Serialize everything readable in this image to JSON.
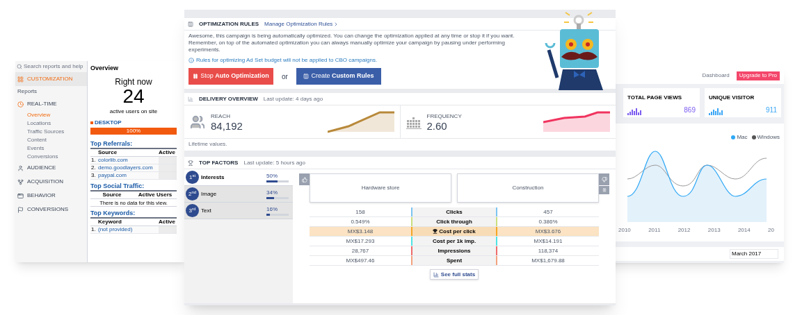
{
  "analytics_window": {
    "search": {
      "placeholder": "Search reports and help"
    },
    "sidebar": {
      "items": [
        {
          "kind": "item",
          "label": "CUSTOMIZATION",
          "selected": true
        },
        {
          "kind": "heading",
          "label": "Reports"
        },
        {
          "kind": "item",
          "label": "REAL-TIME",
          "selected": false,
          "expanded": true,
          "children": [
            {
              "label": "Overview",
              "selected": true
            },
            {
              "label": "Locations",
              "selected": false
            },
            {
              "label": "Traffic Sources",
              "selected": false
            },
            {
              "label": "Content",
              "selected": false
            },
            {
              "label": "Events",
              "selected": false
            },
            {
              "label": "Conversions",
              "selected": false
            }
          ]
        },
        {
          "kind": "item",
          "label": "AUDIENCE",
          "selected": false
        },
        {
          "kind": "item",
          "label": "ACQUISITION",
          "selected": false
        },
        {
          "kind": "item",
          "label": "BEHAVIOR",
          "selected": false
        },
        {
          "kind": "item",
          "label": "CONVERSIONS",
          "selected": false
        }
      ]
    },
    "title": "Overview",
    "right_now": {
      "heading": "Right now",
      "count": "24",
      "caption": "active users on site",
      "device": "DESKTOP",
      "bar_label": "100%",
      "level": 1
    },
    "tables": [
      {
        "title": "Top Referrals:",
        "columns": [
          "",
          "Source",
          "Active"
        ],
        "rows": [
          [
            "1.",
            "colorlib.com"
          ],
          [
            "2.",
            "demo.goodlayers.com"
          ],
          [
            "3.",
            "paypal.com"
          ]
        ]
      },
      {
        "title": "Top Social Traffic:",
        "columns": [
          "Source",
          "Active Users"
        ],
        "empty": "There is no data for this view."
      },
      {
        "title": "Top Keywords:",
        "columns": [
          "",
          "Keyword",
          "Active"
        ],
        "rows": [
          [
            "1.",
            "(not provided)"
          ]
        ]
      }
    ]
  },
  "optimizer_window": {
    "rules": {
      "title": "OPTIMIZATION RULES",
      "link": "Manage Optimization Rules",
      "text": "Awesome, this campaign is being automatically optimized. You can change the optimization applied at any time or stop it if you want. Remember, on top of the automated optimization you can always manually optimize your campaign by pausing under performing experiments.",
      "note": "Rules for optimizing Ad Set budget will not be applied to CBO campaigns.",
      "buttons": [
        {
          "kind": "stop",
          "label": "Stop **Auto Optimization**"
        },
        {
          "kind": "create",
          "label": "Create **Custom Rules**"
        }
      ],
      "separator": "or"
    },
    "delivery": {
      "title": "DELIVERY OVERVIEW",
      "updated": "Last update: 4 days ago",
      "metrics": [
        {
          "kind": "people",
          "label": "REACH",
          "value": "84,192"
        },
        {
          "kind": "bars",
          "label": "FREQUENCY",
          "value": "2.60"
        }
      ],
      "footer": "Lifetime values."
    },
    "factors": {
      "title": "TOP FACTORS",
      "updated": "Last update: 5 hours ago",
      "items": [
        {
          "rank": "1$^{st}$",
          "name": "Interests",
          "percent": "50%",
          "level": 0.5,
          "selected": true
        },
        {
          "rank": "2$^{nd}$",
          "name": "Image",
          "percent": "34%",
          "level": 0.34,
          "selected": false
        },
        {
          "rank": "3$^{rd}$",
          "name": "Text",
          "percent": "16%",
          "level": 0.16,
          "selected": false
        }
      ],
      "compare": [
        "Hardware store",
        "Construction"
      ],
      "rows": [
        {
          "a": "158",
          "metric": "Clicks",
          "b": "457",
          "color": "#7cc4f0",
          "highlighted": false
        },
        {
          "a": "0.549%",
          "metric": "Click through",
          "b": "0.386%",
          "color": "#c9df7e",
          "highlighted": false
        },
        {
          "a": "MX$3.148",
          "metric": "Cost per click",
          "b": "MX$3.676",
          "color": "#f5a623",
          "highlighted": true
        },
        {
          "a": "MX$17.293",
          "metric": "Cost per 1k imp.",
          "b": "MX$14.191",
          "color": "#4fe3e3",
          "highlighted": false
        },
        {
          "a": "28,767",
          "metric": "Impressions",
          "b": "118,374",
          "color": "#ef6b6b",
          "highlighted": false
        },
        {
          "a": "MX$497.46",
          "metric": "Spent",
          "b": "MX$1,679.88",
          "color": "#f3a27e",
          "highlighted": false
        }
      ],
      "button": "See full stats"
    }
  },
  "dashboard_window": {
    "nav": {
      "link": "Dashboard",
      "button": "Upgrade to Pro"
    },
    "cards": [
      {
        "title": "TOTAL PAGE VIEWS",
        "value": "869",
        "color": "#7c5cf0"
      },
      {
        "title": "UNIQUE VISITOR",
        "value": "911",
        "color": "#3aa6f5"
      }
    ],
    "legend": [
      {
        "name": "Mac",
        "color": "#2fa8f5"
      },
      {
        "name": "Windows",
        "color": "#555555"
      }
    ],
    "xticks": [
      "2010",
      "2011",
      "2012",
      "2013",
      "2014",
      "20"
    ],
    "select": "March 2017"
  }
}
